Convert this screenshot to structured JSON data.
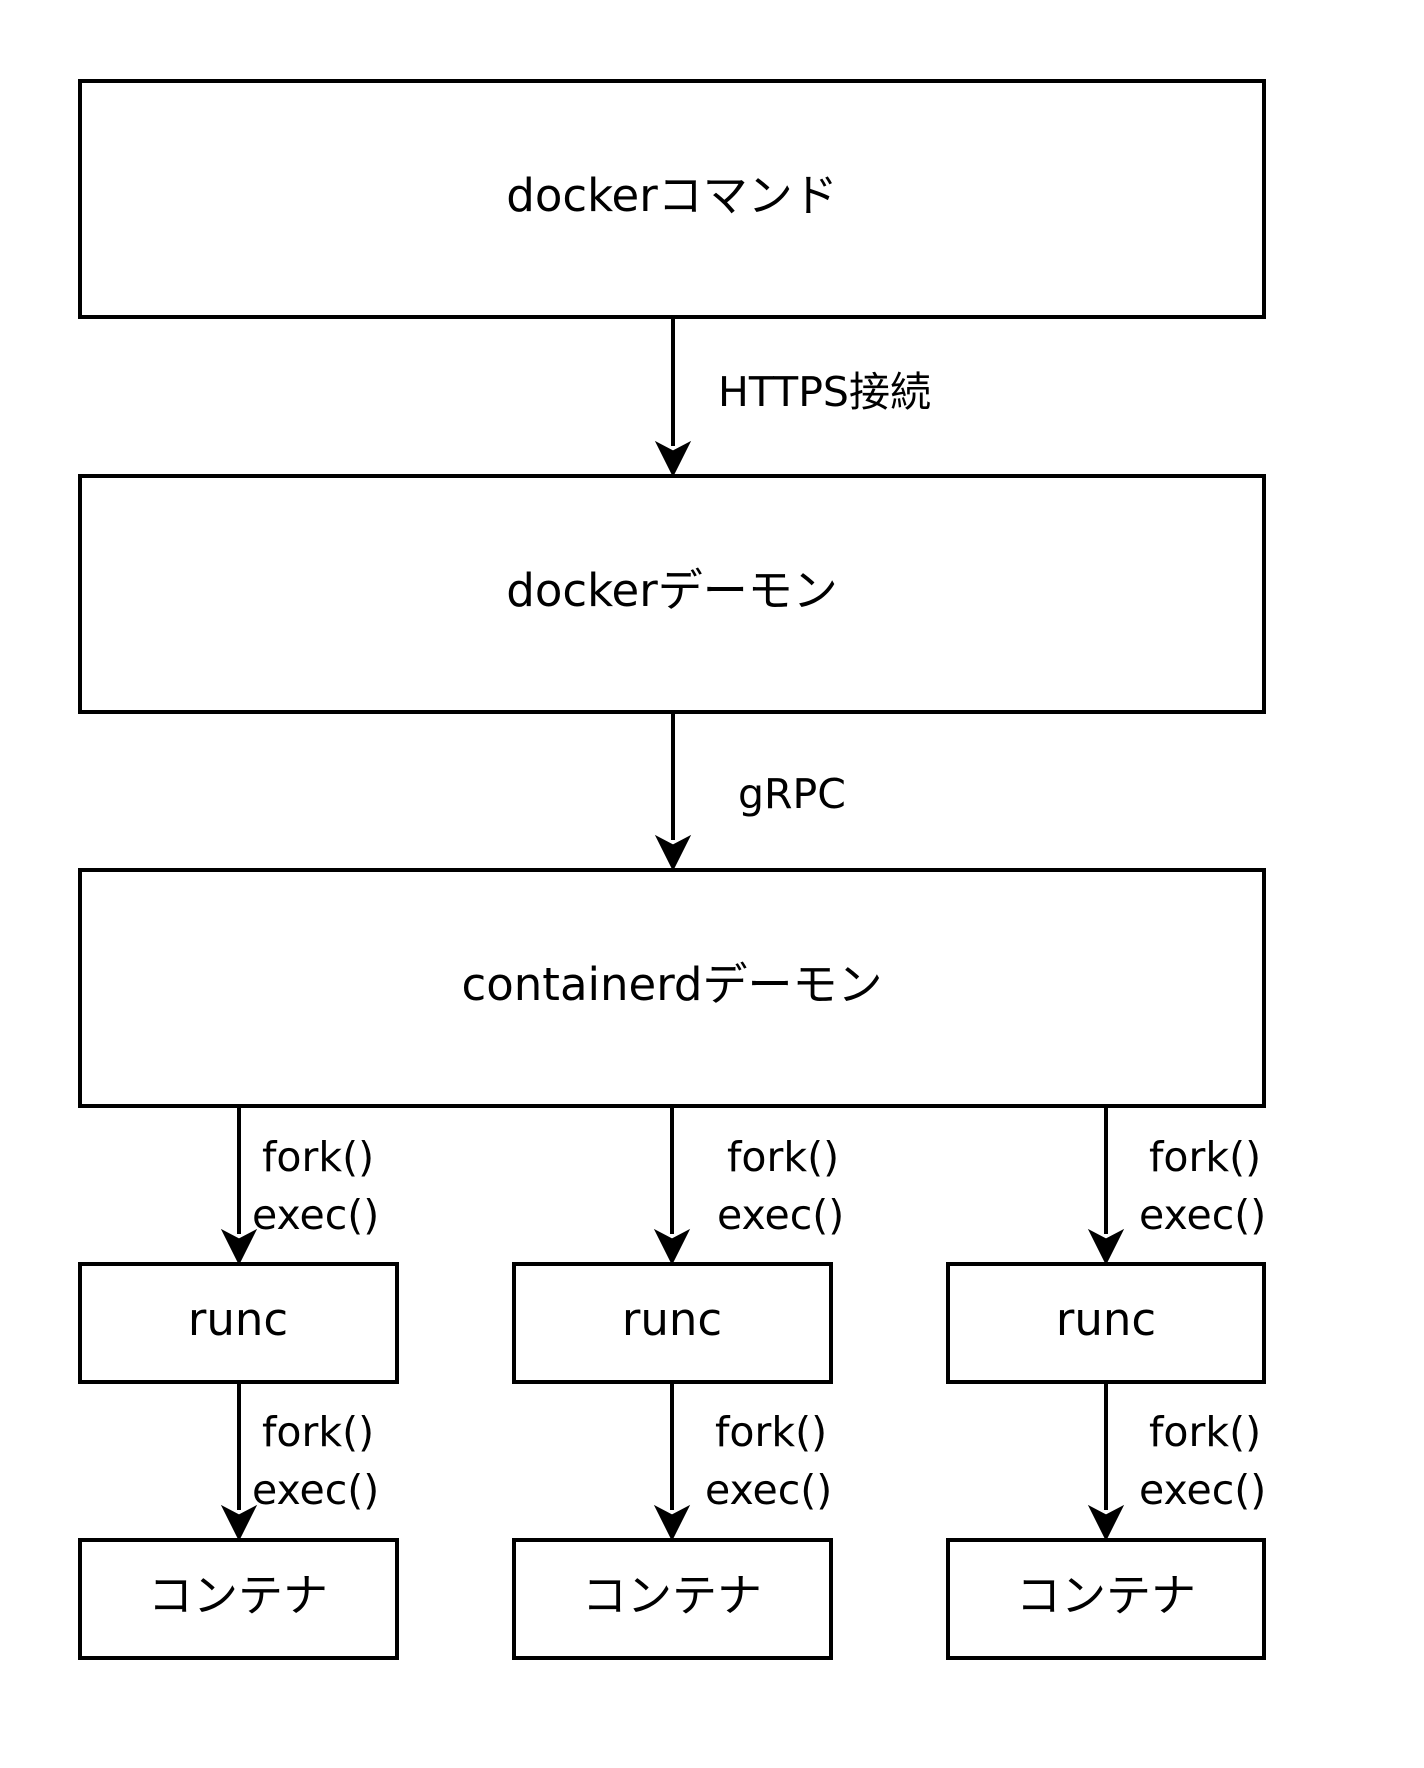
{
  "diagram": {
    "nodes": {
      "docker_command": "dockerコマンド",
      "docker_daemon": "dockerデーモン",
      "containerd_daemon": "containerdデーモン",
      "runc_1": "runc",
      "runc_2": "runc",
      "runc_3": "runc",
      "container_1": "コンテナ",
      "container_2": "コンテナ",
      "container_3": "コンテナ"
    },
    "edges": {
      "command_to_daemon": "HTTPS接続",
      "daemon_to_containerd": "gRPC",
      "fork_label": "fork()",
      "exec_label": "exec()"
    }
  }
}
